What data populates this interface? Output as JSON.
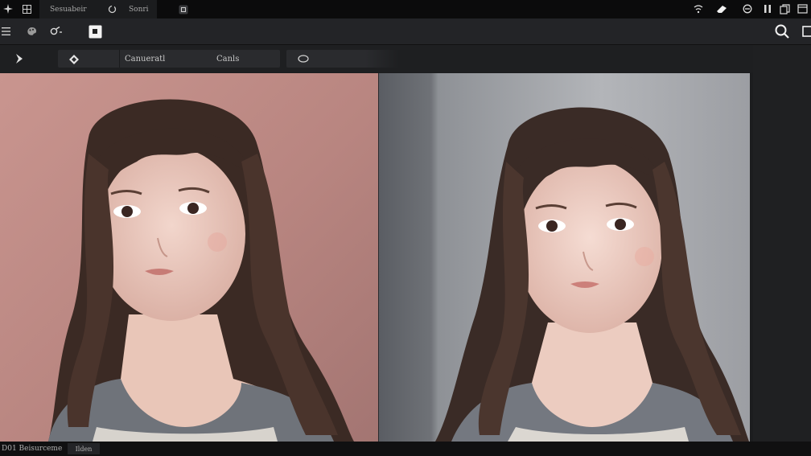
{
  "titlebar": {
    "tabs": [
      {
        "label": "Sesuabeir"
      },
      {
        "label": "Sonri"
      }
    ]
  },
  "optionsbar": {
    "preset_label": "Canueratl",
    "mode_label": "Canls"
  },
  "statusbar": {
    "left_text": "D01 Beisurceme",
    "zoom_text": "Ilden"
  },
  "colors": {
    "left_background": "#c0908a",
    "right_background": "#aeb0b4",
    "hair": "#3b2a24",
    "sweater": "#707479"
  },
  "icons": [
    "sparkle-icon",
    "grid-icon",
    "refresh-icon",
    "tab-close-icon",
    "wifi-icon",
    "eraser-icon",
    "settings-icon",
    "pause-icon",
    "copy-icon",
    "hamburger-menu-icon",
    "palette-icon",
    "brush-icon",
    "layer-icon",
    "search-icon",
    "panel-icon",
    "arrow-right-icon",
    "diamond-icon",
    "lasso-icon"
  ]
}
